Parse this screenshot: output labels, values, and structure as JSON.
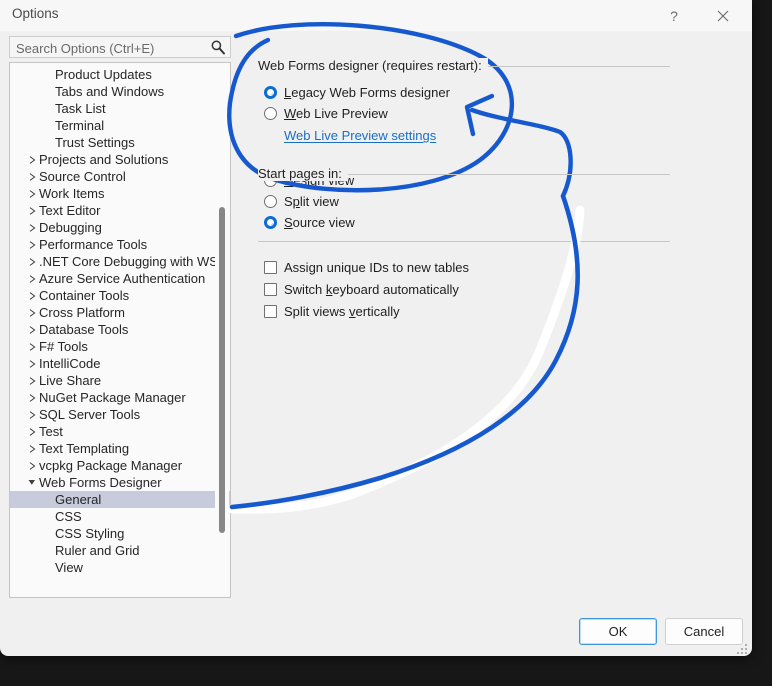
{
  "window": {
    "title": "Options",
    "help_icon": "question-mark-icon",
    "help_label": "?",
    "close_icon": "close-icon"
  },
  "search": {
    "placeholder": "Search Options (Ctrl+E)",
    "value": "",
    "icon": "search-icon"
  },
  "tree": {
    "items": [
      {
        "label": "Product Updates",
        "level": 2,
        "twisty": "none",
        "selected": false
      },
      {
        "label": "Tabs and Windows",
        "level": 2,
        "twisty": "none",
        "selected": false
      },
      {
        "label": "Task List",
        "level": 2,
        "twisty": "none",
        "selected": false
      },
      {
        "label": "Terminal",
        "level": 2,
        "twisty": "none",
        "selected": false
      },
      {
        "label": "Trust Settings",
        "level": 2,
        "twisty": "none",
        "selected": false
      },
      {
        "label": "Projects and Solutions",
        "level": 1,
        "twisty": "collapsed",
        "selected": false
      },
      {
        "label": "Source Control",
        "level": 1,
        "twisty": "collapsed",
        "selected": false
      },
      {
        "label": "Work Items",
        "level": 1,
        "twisty": "collapsed",
        "selected": false
      },
      {
        "label": "Text Editor",
        "level": 1,
        "twisty": "collapsed",
        "selected": false
      },
      {
        "label": "Debugging",
        "level": 1,
        "twisty": "collapsed",
        "selected": false
      },
      {
        "label": "Performance Tools",
        "level": 1,
        "twisty": "collapsed",
        "selected": false
      },
      {
        "label": ".NET Core Debugging with WSL",
        "level": 1,
        "twisty": "collapsed",
        "selected": false
      },
      {
        "label": "Azure Service Authentication",
        "level": 1,
        "twisty": "collapsed",
        "selected": false
      },
      {
        "label": "Container Tools",
        "level": 1,
        "twisty": "collapsed",
        "selected": false
      },
      {
        "label": "Cross Platform",
        "level": 1,
        "twisty": "collapsed",
        "selected": false
      },
      {
        "label": "Database Tools",
        "level": 1,
        "twisty": "collapsed",
        "selected": false
      },
      {
        "label": "F# Tools",
        "level": 1,
        "twisty": "collapsed",
        "selected": false
      },
      {
        "label": "IntelliCode",
        "level": 1,
        "twisty": "collapsed",
        "selected": false
      },
      {
        "label": "Live Share",
        "level": 1,
        "twisty": "collapsed",
        "selected": false
      },
      {
        "label": "NuGet Package Manager",
        "level": 1,
        "twisty": "collapsed",
        "selected": false
      },
      {
        "label": "SQL Server Tools",
        "level": 1,
        "twisty": "collapsed",
        "selected": false
      },
      {
        "label": "Test",
        "level": 1,
        "twisty": "collapsed",
        "selected": false
      },
      {
        "label": "Text Templating",
        "level": 1,
        "twisty": "collapsed",
        "selected": false
      },
      {
        "label": "vcpkg Package Manager",
        "level": 1,
        "twisty": "collapsed",
        "selected": false
      },
      {
        "label": "Web Forms Designer",
        "level": 1,
        "twisty": "expanded",
        "selected": false
      },
      {
        "label": "General",
        "level": 2,
        "twisty": "none",
        "selected": true
      },
      {
        "label": "CSS",
        "level": 2,
        "twisty": "none",
        "selected": false
      },
      {
        "label": "CSS Styling",
        "level": 2,
        "twisty": "none",
        "selected": false
      },
      {
        "label": "Ruler and Grid",
        "level": 2,
        "twisty": "none",
        "selected": false
      },
      {
        "label": "View",
        "level": 2,
        "twisty": "none",
        "selected": false
      }
    ],
    "selected_label": "General",
    "scrollbar": "vertical-scrollbar"
  },
  "pane": {
    "group1": {
      "label": "Web Forms designer (requires restart):",
      "options": [
        {
          "label": "Legacy Web Forms designer",
          "mnemonic": "L",
          "checked": true
        },
        {
          "label": "Web Live Preview",
          "mnemonic": "W",
          "checked": false
        }
      ],
      "link": "Web Live Preview settings"
    },
    "group2": {
      "label": "Start pages in:",
      "options": [
        {
          "label": "Design view",
          "mnemonic": "D",
          "checked": false
        },
        {
          "label": "Split view",
          "mnemonic": "p",
          "checked": false
        },
        {
          "label": "Source view",
          "mnemonic": "S",
          "checked": true
        }
      ]
    },
    "group3": {
      "checkboxes": [
        {
          "label": "Assign unique IDs to new tables",
          "mnemonic": "g",
          "checked": false
        },
        {
          "label": "Switch keyboard automatically",
          "mnemonic": "k",
          "checked": false
        },
        {
          "label": "Split views vertically",
          "mnemonic": "v",
          "checked": false
        }
      ]
    }
  },
  "footer": {
    "ok_label": "OK",
    "cancel_label": "Cancel",
    "resize_grip": "resize-grip-icon"
  },
  "annotation": {
    "color": "#1659cf",
    "shapes": [
      "ellipse-highlight",
      "arrow-pointer",
      "long-curve-line"
    ]
  },
  "colors": {
    "accent": "#0a6cd4",
    "link": "#1a6fc4",
    "selection": "#c8cbdb",
    "dialog_bg": "#f0f0f0",
    "annotation": "#1659cf"
  }
}
